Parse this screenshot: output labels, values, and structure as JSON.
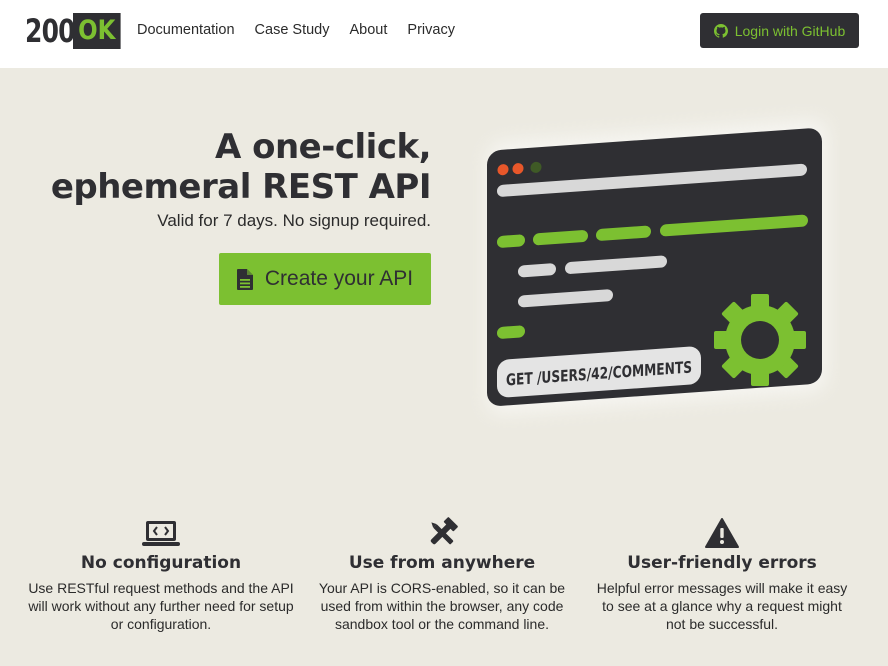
{
  "header": {
    "logo": {
      "number": "200",
      "badge": "OK"
    },
    "nav": [
      "Documentation",
      "Case Study",
      "About",
      "Privacy"
    ],
    "login_label": "Login with GitHub"
  },
  "hero": {
    "title_line1": "A one-click,",
    "title_line2": "ephemeral REST API",
    "subtitle": "Valid for 7 days. No signup required.",
    "cta_label": "Create your API"
  },
  "illustration": {
    "endpoint": "GET /USERS/42/COMMENTS"
  },
  "features": [
    {
      "icon": "laptop-code-icon",
      "title": "No configuration",
      "text": "Use RESTful request methods and the API will work without any further need for setup or configuration."
    },
    {
      "icon": "tools-icon",
      "title": "Use from anywhere",
      "text": "Your API is CORS-enabled, so it can be used from within the browser, any code sandbox tool or the command line."
    },
    {
      "icon": "warning-icon",
      "title": "User-friendly errors",
      "text": "Helpful error messages will make it easy to see at a glance why a request might not be successful."
    }
  ],
  "colors": {
    "accent": "#7cc031",
    "dark": "#2f2f33",
    "background": "#eceae1"
  }
}
